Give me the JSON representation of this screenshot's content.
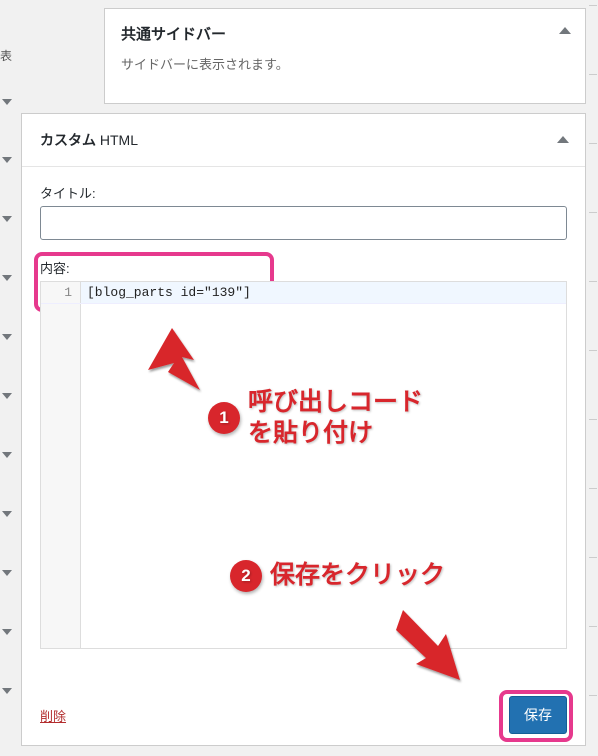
{
  "page": {
    "left_label": "表"
  },
  "sidebar_panel": {
    "title": "共通サイドバー",
    "subtitle": "サイドバーに表示されます。"
  },
  "widget": {
    "title_bold": "カスタム",
    "title_thin": "HTML",
    "field_title_label": "タイトル:",
    "title_value": "",
    "field_content_label": "内容:",
    "code_line_number": "1",
    "code_content": "[blog_parts id=\"139\"]",
    "delete_label": "削除",
    "save_label": "保存"
  },
  "annotations": {
    "step1_number": "1",
    "step1_text": "呼び出しコード\nを貼り付け",
    "step2_number": "2",
    "step2_text": "保存をクリック"
  },
  "colors": {
    "annotation_red": "#d8262c",
    "highlight_pink": "#e6398d",
    "primary_button": "#2271b1",
    "delete_red": "#b32d2e"
  }
}
